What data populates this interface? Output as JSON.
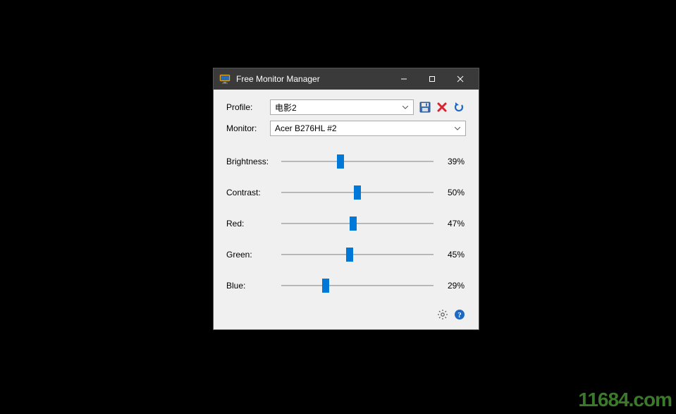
{
  "window": {
    "title": "Free Monitor Manager"
  },
  "form": {
    "profile_label": "Profile:",
    "profile_value": "电影2",
    "monitor_label": "Monitor:",
    "monitor_value": "Acer B276HL #2"
  },
  "sliders": [
    {
      "label": "Brightness:",
      "value": 39,
      "display": "39%"
    },
    {
      "label": "Contrast:",
      "value": 50,
      "display": "50%"
    },
    {
      "label": "Red:",
      "value": 47,
      "display": "47%"
    },
    {
      "label": "Green:",
      "value": 45,
      "display": "45%"
    },
    {
      "label": "Blue:",
      "value": 29,
      "display": "29%"
    }
  ],
  "watermark": "11684.com"
}
